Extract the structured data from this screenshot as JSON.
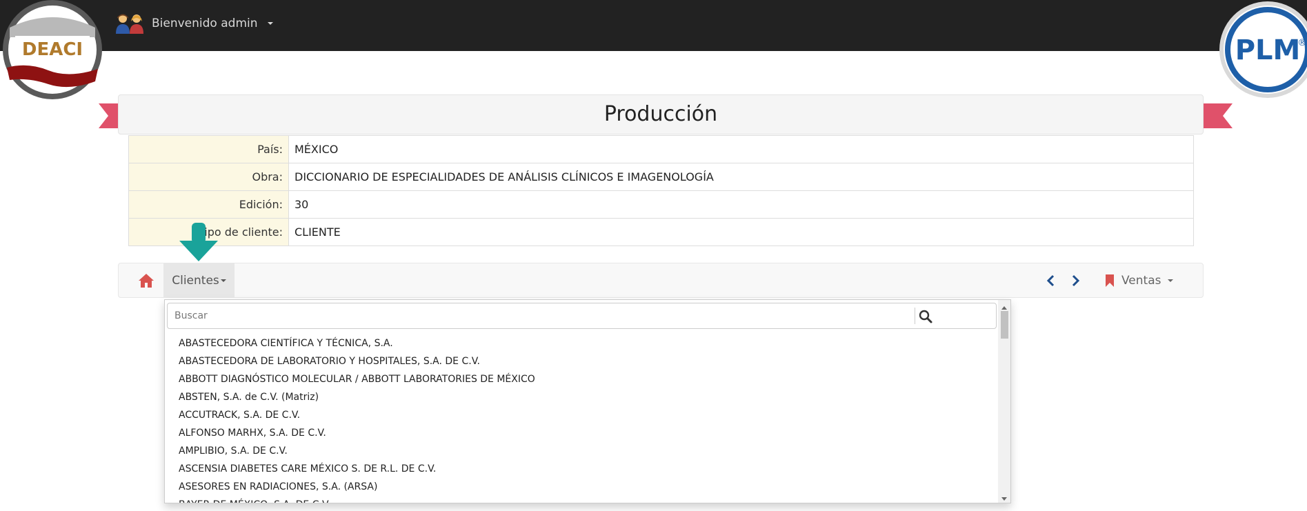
{
  "header": {
    "welcome_label": "Bienvenido admin",
    "user_icon": "users-icon",
    "logo_left_text": "DEACI",
    "logo_right_text": "PLM",
    "logo_right_mark": "®"
  },
  "page": {
    "title": "Producción",
    "ribbon_color": "#e0516a"
  },
  "info": {
    "rows": [
      {
        "label": "País:",
        "value": "MÉXICO"
      },
      {
        "label": "Obra:",
        "value": "DICCIONARIO DE ESPECIALIDADES DE ANÁLISIS CLÍNICOS E IMAGENOLOGÍA"
      },
      {
        "label": "Edición:",
        "value": "30"
      },
      {
        "label": "Tipo de cliente:",
        "value": "CLIENTE"
      }
    ]
  },
  "nav": {
    "home_icon": "home-icon",
    "clientes_label": "Clientes",
    "prev_icon": "chevron-left-icon",
    "next_icon": "chevron-right-icon",
    "ventas_icon": "bookmark-icon",
    "ventas_label": "Ventas"
  },
  "dropdown": {
    "search_placeholder": "Buscar",
    "search_icon": "search-icon",
    "items": [
      "ABASTECEDORA CIENTÍFICA Y TÉCNICA, S.A.",
      "ABASTECEDORA DE LABORATORIO Y HOSPITALES, S.A. DE C.V.",
      "ABBOTT DIAGNÓSTICO MOLECULAR / ABBOTT LABORATORIES DE MÉXICO",
      "ABSTEN, S.A. de C.V. (Matriz)",
      "ACCUTRACK, S.A. DE C.V.",
      "ALFONSO MARHX, S.A. DE C.V.",
      "AMPLIBIO, S.A. DE C.V.",
      "ASCENSIA DIABETES CARE MÉXICO S. DE R.L. DE C.V.",
      "ASESORES EN RADIACIONES, S.A. (ARSA)",
      "BAYER DE MÉXICO, S.A. DE C.V."
    ]
  },
  "colors": {
    "topbar": "#222222",
    "accent_red": "#d9534f",
    "arrow_teal": "#1aa39a",
    "label_bg": "#fcf8e3"
  }
}
